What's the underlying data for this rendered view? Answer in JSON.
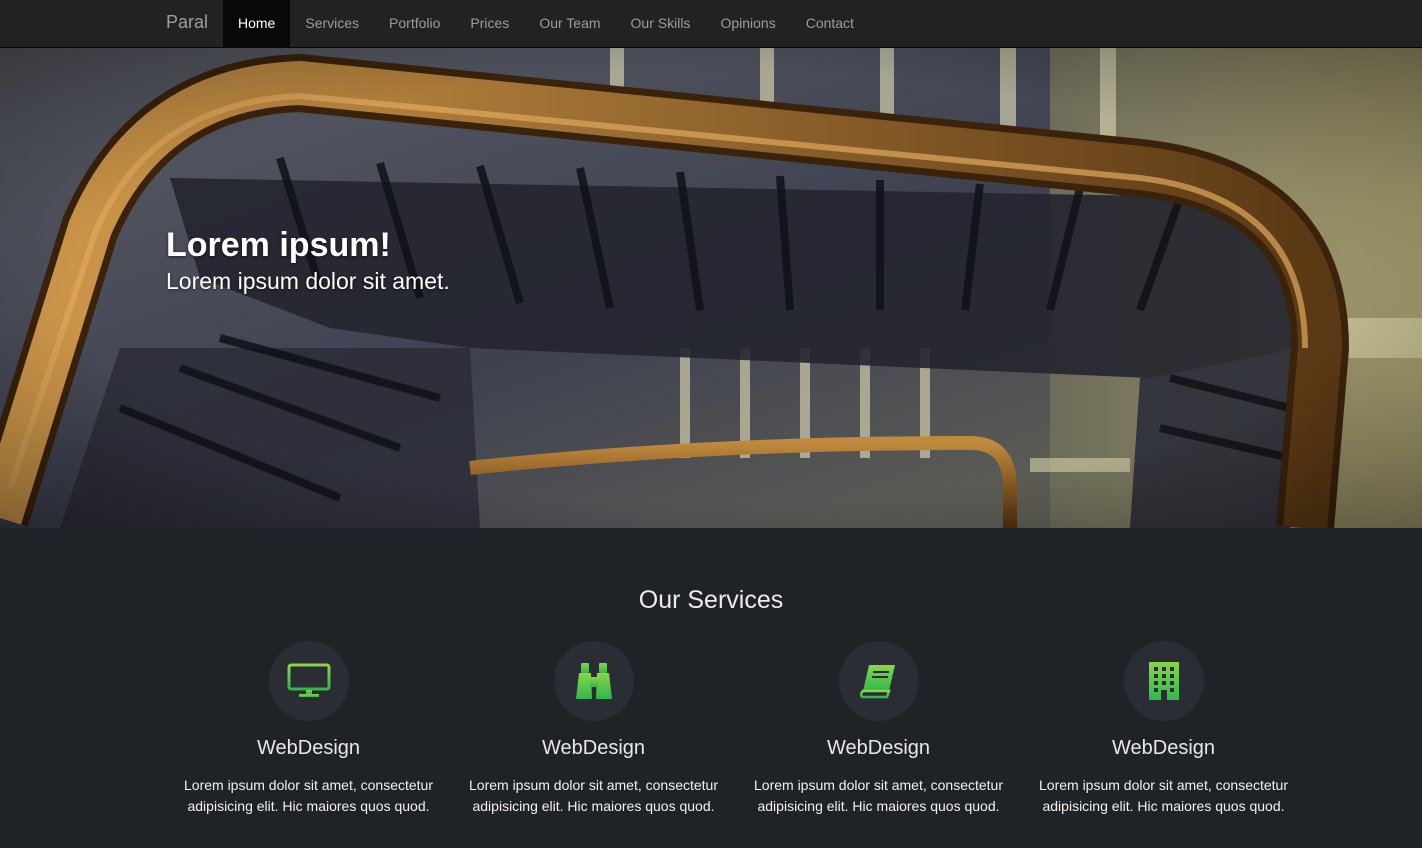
{
  "navbar": {
    "brand": "Paral",
    "items": [
      {
        "label": "Home",
        "active": true
      },
      {
        "label": "Services"
      },
      {
        "label": "Portfolio"
      },
      {
        "label": "Prices"
      },
      {
        "label": "Our Team"
      },
      {
        "label": "Our Skills"
      },
      {
        "label": "Opinions"
      },
      {
        "label": "Contact"
      }
    ]
  },
  "hero": {
    "title": "Lorem ipsum!",
    "subtitle": "Lorem ipsum dolor sit amet."
  },
  "services": {
    "title": "Our Services",
    "items": [
      {
        "icon": "monitor-icon",
        "title": "WebDesign",
        "text": "Lorem ipsum dolor sit amet, consectetur adipisicing elit. Hic maiores quos quod."
      },
      {
        "icon": "binoculars-icon",
        "title": "WebDesign",
        "text": "Lorem ipsum dolor sit amet, consectetur adipisicing elit. Hic maiores quos quod."
      },
      {
        "icon": "book-icon",
        "title": "WebDesign",
        "text": "Lorem ipsum dolor sit amet, consectetur adipisicing elit. Hic maiores quos quod."
      },
      {
        "icon": "building-icon",
        "title": "WebDesign",
        "text": "Lorem ipsum dolor sit amet, consectetur adipisicing elit. Hic maiores quos quod."
      }
    ]
  },
  "colors": {
    "navbar_bg": "#222222",
    "nav_active_bg": "#080808",
    "page_bg": "#1f2227",
    "icon_gradient_top": "#8bd448",
    "icon_gradient_bottom": "#2fb84f"
  }
}
